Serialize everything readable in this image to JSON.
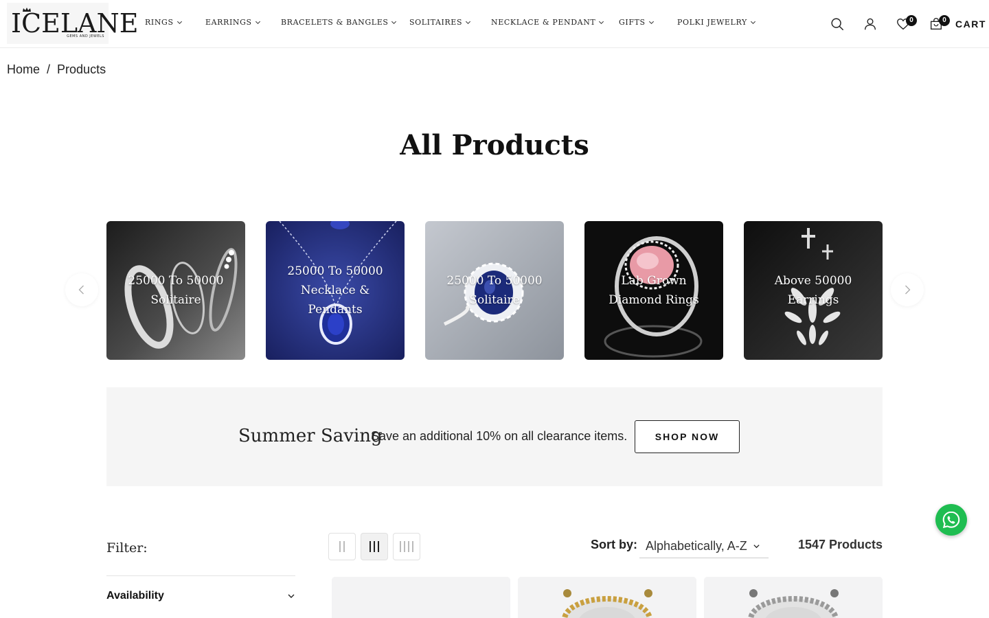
{
  "header": {
    "logo_text": "ICELANE",
    "logo_tagline": "GEMS AND JEWELS",
    "nav": [
      {
        "label": "RINGS"
      },
      {
        "label": "EARRINGS"
      },
      {
        "label": "BRACELETS & BANGLES"
      },
      {
        "label": "SOLITAIRES"
      },
      {
        "label": "NECKLACE & PENDANT"
      },
      {
        "label": "GIFTS"
      },
      {
        "label": "POLKI JEWELRY"
      }
    ],
    "wishlist_count": "0",
    "cart_count": "0",
    "cart_label": "CART"
  },
  "breadcrumb": {
    "home": "Home",
    "separator": "/",
    "current": "Products"
  },
  "page_title": "All Products",
  "collections": [
    {
      "label": "25000 To 50000 Solitaire"
    },
    {
      "label": "25000 To 50000 Necklace & Pendants"
    },
    {
      "label": "25000 To 50000 Solitaire"
    },
    {
      "label": "Lab Grown Diamond Rings"
    },
    {
      "label": "Above 50000 Earrings"
    }
  ],
  "promo": {
    "title": "Summer Saving",
    "text": "Save an additional 10% on all clearance items.",
    "button": "SHOP NOW"
  },
  "filter": {
    "label": "Filter:",
    "availability": "Availability"
  },
  "toolbar": {
    "sort_label": "Sort by:",
    "sort_value": "Alphabetically, A-Z",
    "product_count": "1547 Products",
    "active_layout": "3-columns"
  },
  "colors": {
    "accent": "#111111",
    "whatsapp": "#1fbd51",
    "banner_bg": "#f5f5f5"
  }
}
